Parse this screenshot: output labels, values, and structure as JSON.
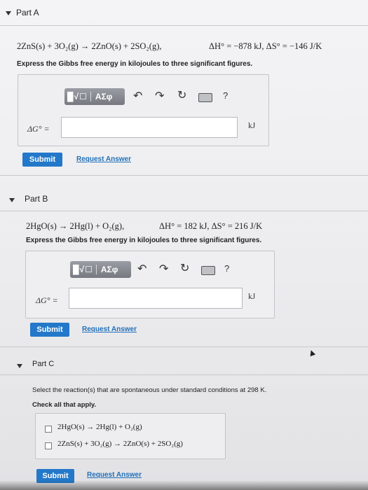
{
  "partA": {
    "title": "Part A",
    "reaction": "2ZnS(s) + 3O₂(g) → 2ZnO(s) + 2SO₂(g),",
    "thermo": "ΔH° = −878 kJ, ΔS° = −146 J/K",
    "instruction": "Express the Gibbs free energy in kilojoules to three significant figures.",
    "toolbar_templates": "█√☐",
    "toolbar_greek": "ΑΣφ",
    "answer_label": "ΔG° =",
    "answer_value": "",
    "unit": "kJ",
    "submit": "Submit",
    "request": "Request Answer"
  },
  "partB": {
    "title": "Part B",
    "reaction": "2HgO(s) → 2Hg(l) + O₂(g),",
    "thermo": "ΔH° = 182 kJ, ΔS° = 216 J/K",
    "instruction": "Express the Gibbs free energy in kilojoules to three significant figures.",
    "toolbar_templates": "█√☐",
    "toolbar_greek": "ΑΣφ",
    "answer_label": "ΔG° =",
    "answer_value": "",
    "unit": "kJ",
    "submit": "Submit",
    "request": "Request Answer"
  },
  "partC": {
    "title": "Part C",
    "prompt": "Select the reaction(s) that are spontaneous under standard conditions at 298 K.",
    "instruction": "Check all that apply.",
    "options": [
      "2HgO(s) → 2Hg(l) + O₂(g)",
      "2ZnS(s) + 3O₂(g) → 2ZnO(s) + 2SO₂(g)"
    ],
    "submit": "Submit",
    "request": "Request Answer"
  },
  "toolbar_icons": [
    "undo-icon",
    "redo-icon",
    "reset-icon",
    "keyboard-icon",
    "help-icon"
  ],
  "colors": {
    "accent": "#2378c9",
    "link": "#2170b8",
    "toolbar": "#85898f"
  }
}
